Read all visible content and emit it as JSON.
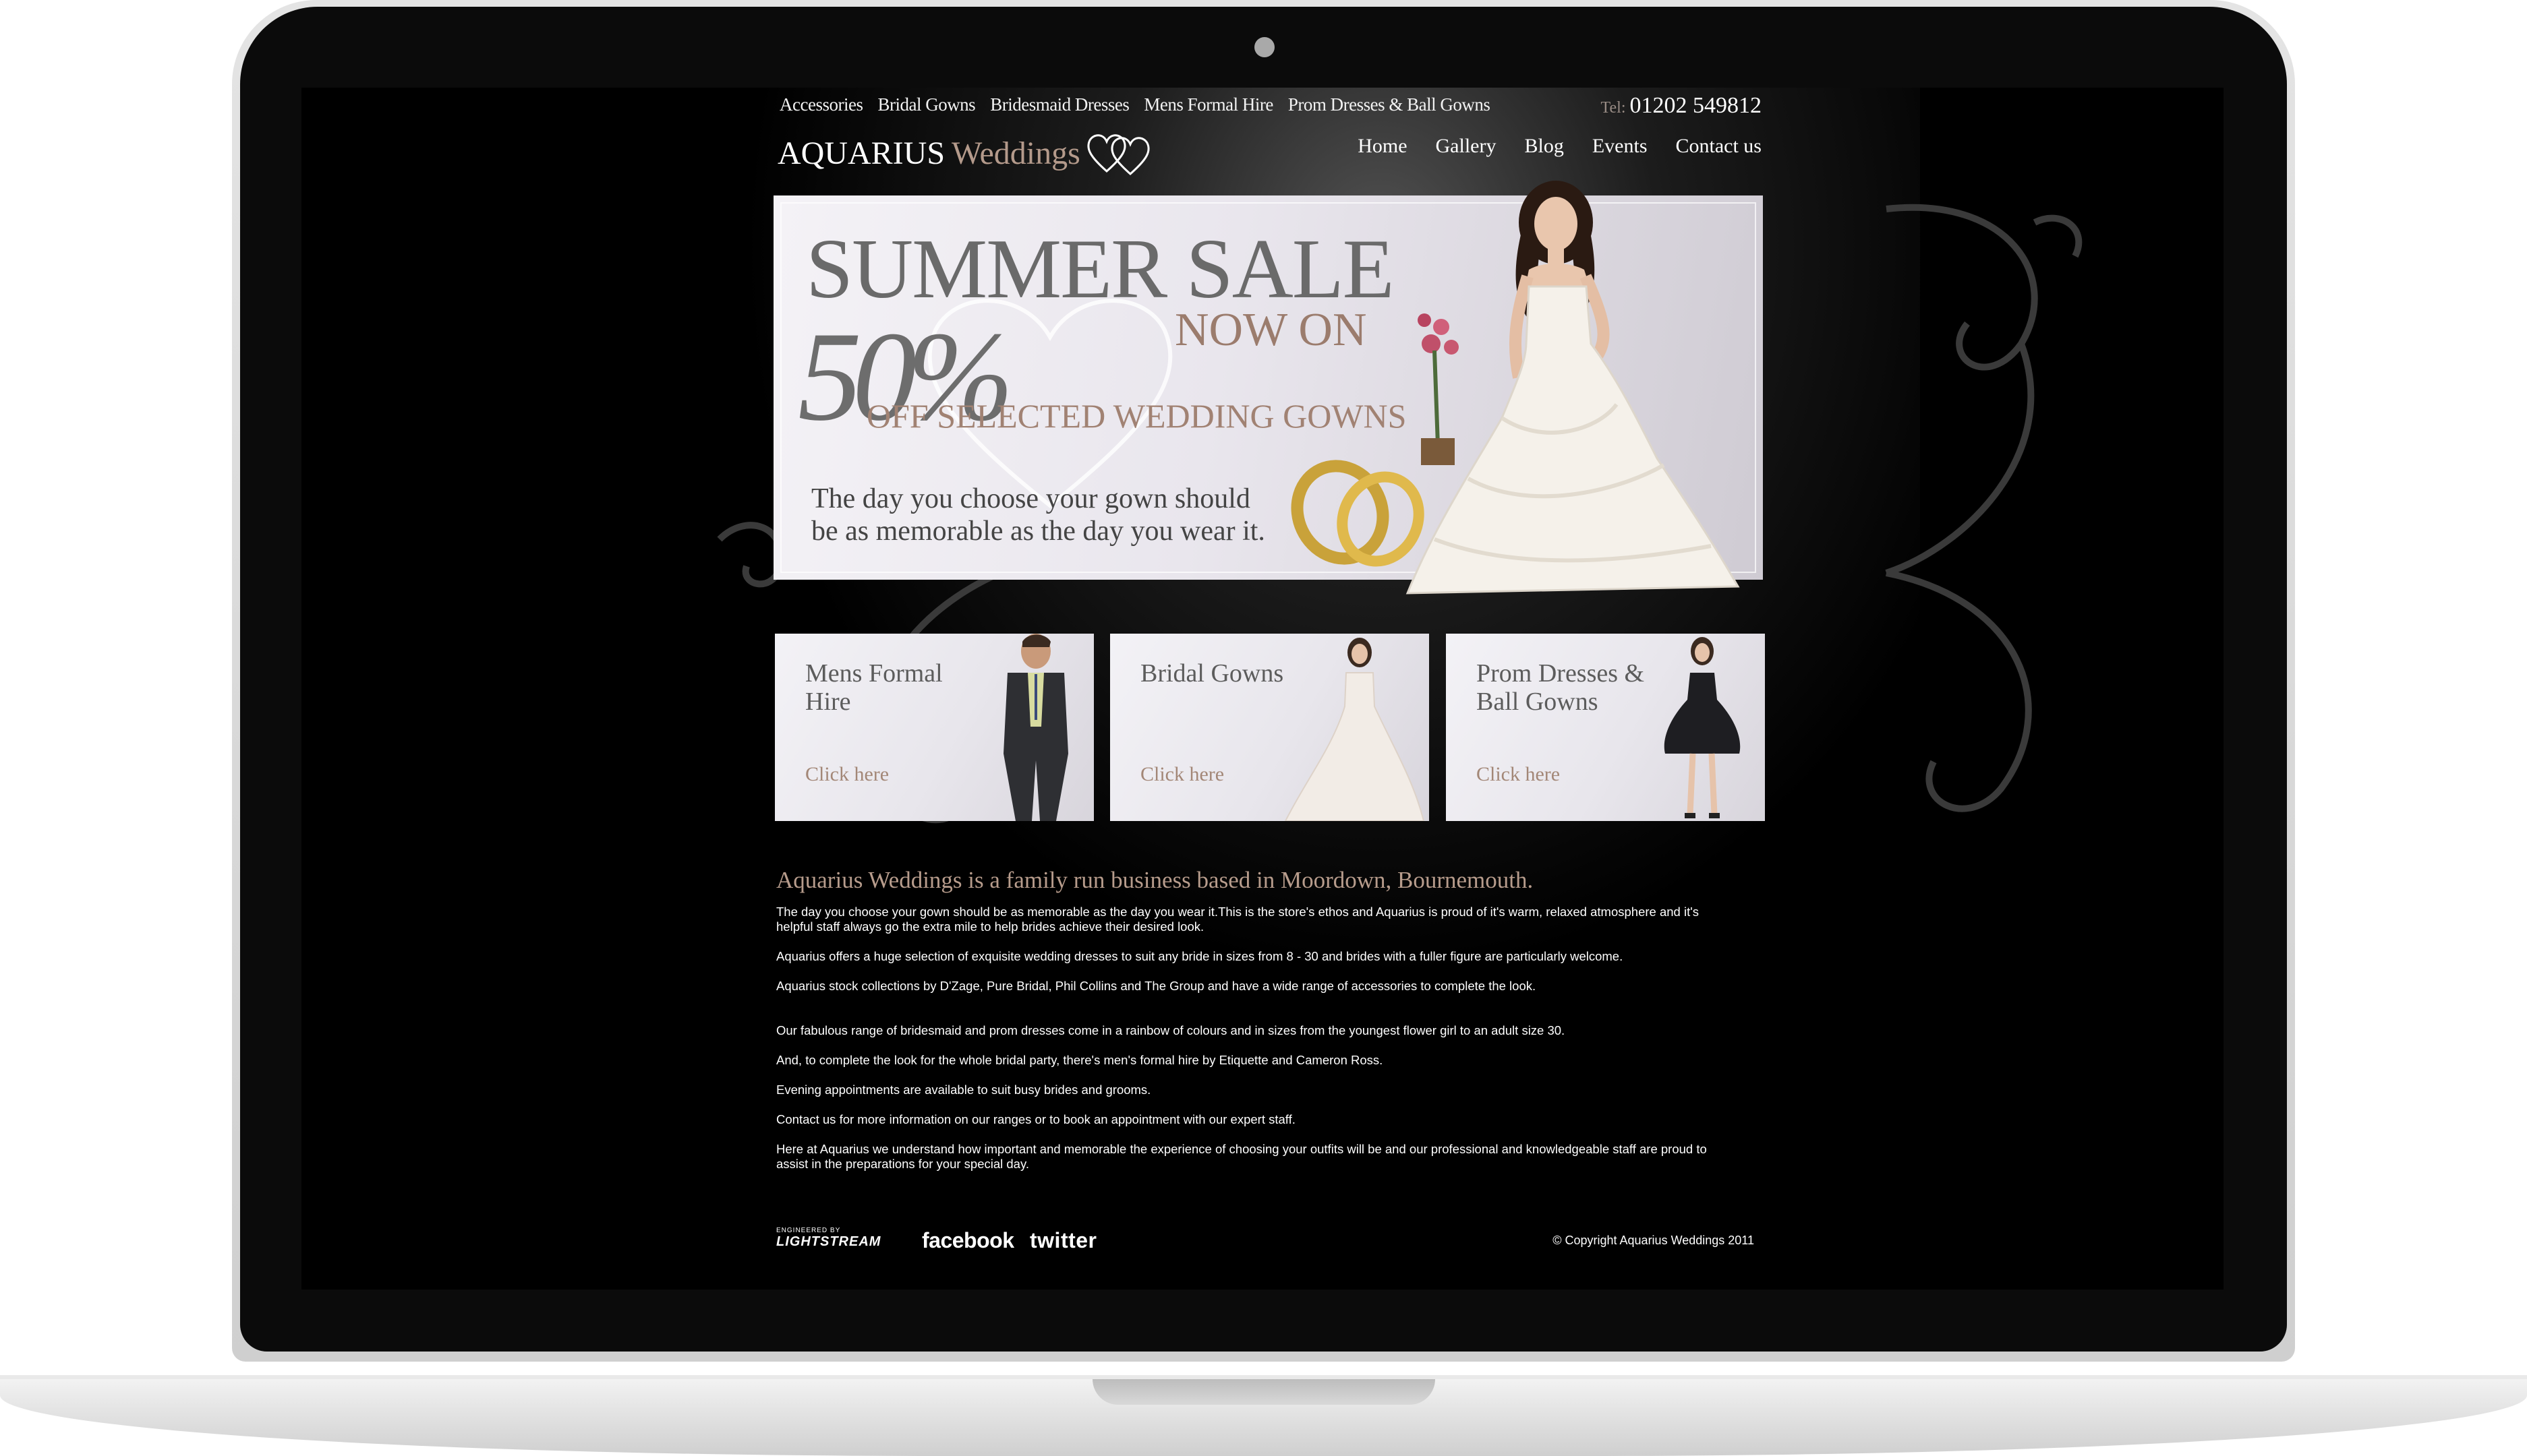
{
  "top_nav": [
    "Accessories",
    "Bridal Gowns",
    "Bridesmaid Dresses",
    "Mens Formal Hire",
    "Prom Dresses & Ball Gowns"
  ],
  "phone": {
    "prefix": "Tel:",
    "number": "01202 549812"
  },
  "logo": {
    "main": "AQUARIUS",
    "accent": "Weddings"
  },
  "main_nav": [
    "Home",
    "Gallery",
    "Blog",
    "Events",
    "Contact us"
  ],
  "banner": {
    "title": "SUMMER SALE",
    "now_on": "NOW ON",
    "percent": "50%",
    "off": "OFF SELECTED WEDDING GOWNS",
    "tagline": "The day you choose your gown should be as memorable as the day you wear it."
  },
  "features": [
    {
      "title": "Mens Formal Hire",
      "link": "Click here"
    },
    {
      "title": "Bridal Gowns",
      "link": "Click here"
    },
    {
      "title": "Prom Dresses & Ball Gowns",
      "link": "Click here"
    }
  ],
  "intro_heading": "Aquarius Weddings is a family run business based in Moordown, Bournemouth.",
  "paragraphs": [
    "The day you choose your gown should be as memorable as the day you wear it.This is the store's ethos and Aquarius is proud of it's warm, relaxed atmosphere and it's helpful staff always go the extra mile to help brides achieve their desired look.",
    "Aquarius offers a huge selection of exquisite wedding dresses to suit any bride in sizes from 8 - 30 and brides with a fuller figure are particularly welcome.",
    "Aquarius stock collections by D'Zage, Pure Bridal, Phil Collins and The Group and have a wide range of accessories to complete the look.",
    "Our fabulous range of bridesmaid and prom dresses come in a rainbow of colours and in sizes from the youngest flower girl to an adult size 30.",
    "And, to complete the look for the whole bridal party, there's men's formal hire by Etiquette and Cameron Ross.",
    "Evening appointments are available to suit busy brides and grooms.",
    "Contact us for more information on our ranges or to book an appointment with our expert staff.",
    "Here at Aquarius we understand how important and memorable the experience of choosing your outfits will be and our professional and knowledgeable staff are proud to assist in the preparations for your special day."
  ],
  "footer": {
    "engineered_by": "ENGINEERED BY",
    "lightstream": "LIGHTSTREAM",
    "facebook": "facebook",
    "twitter": "twitter",
    "copyright": "© Copyright Aquarius Weddings 2011"
  }
}
